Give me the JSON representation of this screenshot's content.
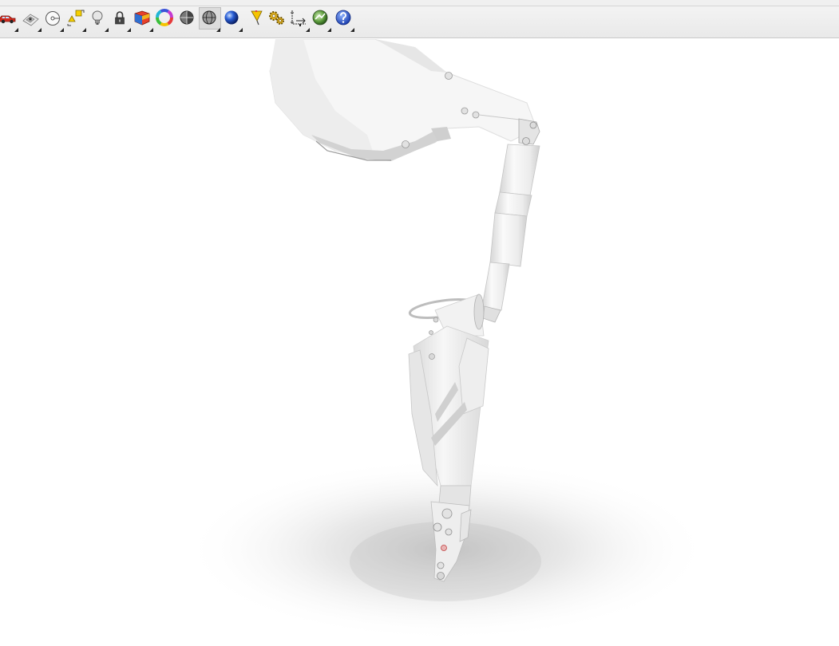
{
  "toolbar": {
    "tools": [
      {
        "name": "render-icon"
      },
      {
        "name": "render-preview-icon"
      },
      {
        "name": "environment-icon"
      },
      {
        "name": "ground-plane-icon"
      },
      {
        "name": "light-icon"
      },
      {
        "name": "lock-icon"
      },
      {
        "name": "material-icon"
      },
      {
        "name": "color-wheel-icon"
      },
      {
        "name": "sphere-icon"
      },
      {
        "name": "wireframe-sphere-icon"
      },
      {
        "name": "blue-sphere-icon"
      },
      {
        "name": "decal-icon"
      },
      {
        "name": "settings-gears-icon"
      },
      {
        "name": "dimension-icon"
      },
      {
        "name": "globe-icon"
      },
      {
        "name": "help-icon"
      }
    ]
  },
  "viewport": {
    "content": "rendered-robotic-arm",
    "background_color": "#ffffff",
    "model_color": "#f2f2f2"
  }
}
